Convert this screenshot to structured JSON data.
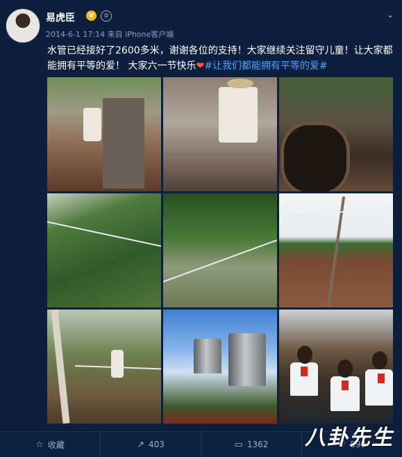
{
  "user": {
    "name": "易虎臣",
    "verified_badge": "V",
    "crown_badge": "♔"
  },
  "meta": {
    "time": "2014-6-1 17:14",
    "from": "来自",
    "client": "iPhone客户端"
  },
  "post": {
    "text": "水管已经接好了2600多米，谢谢各位的支持！大家继续关注留守儿童！让大家都能拥有平等的爱！ 大家六一节快乐",
    "heart": "❤",
    "topic": "#让我们都能拥有平等的爱#"
  },
  "actions": [
    {
      "label": "收藏",
      "icon": "☆"
    },
    {
      "label": "403",
      "icon": "↗"
    },
    {
      "label": "1362",
      "icon": "▭"
    },
    {
      "label": "893",
      "icon": "♡"
    }
  ],
  "watermark": "八卦先生",
  "colors": {
    "background": "#0c1f3d",
    "topic_link": "#4aa3ff",
    "verified": "#f1b51c"
  }
}
